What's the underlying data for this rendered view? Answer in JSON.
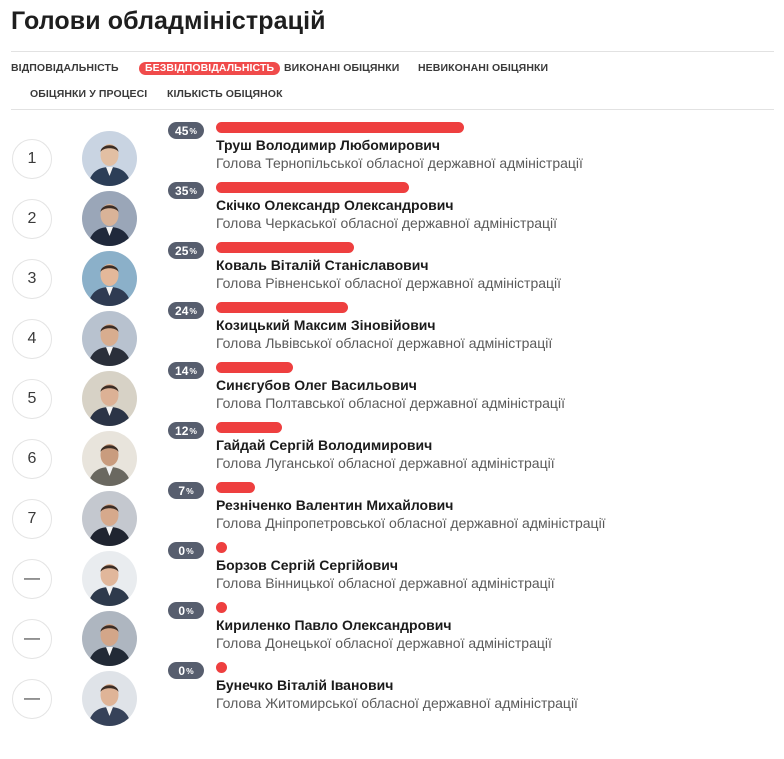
{
  "page": {
    "title": "Голови обладміністрацій"
  },
  "tabs": [
    {
      "label": "ВІДПОВІДАЛЬНІСТЬ",
      "active": false
    },
    {
      "label": "БЕЗВІДПОВІДАЛЬНІСТЬ",
      "active": true
    },
    {
      "label": "ВИКОНАНІ ОБІЦЯНКИ",
      "active": false
    },
    {
      "label": "НЕВИКОНАНІ ОБІЦЯНКИ",
      "active": false
    },
    {
      "label": "ОБІЦЯНКИ У ПРОЦЕСІ",
      "active": false
    },
    {
      "label": "КІЛЬКІСТЬ ОБІЦЯНОК",
      "active": false
    }
  ],
  "percent_sign": "%",
  "colors": {
    "bar": "#ee3f3f",
    "badge": "#575e6e",
    "active_tab": "#f04b4b"
  },
  "rows": [
    {
      "rank": "1",
      "percent": 45,
      "name": "Труш Володимир Любомирович",
      "role": "Голова Тернопільської обласної державної адміністрації"
    },
    {
      "rank": "2",
      "percent": 35,
      "name": "Скічко Олександр Олександрович",
      "role": "Голова Черкаської обласної державної адміністрації"
    },
    {
      "rank": "3",
      "percent": 25,
      "name": "Коваль Віталій Станіславович",
      "role": "Голова Рівненської обласної державної адміністрації"
    },
    {
      "rank": "4",
      "percent": 24,
      "name": "Козицький Максим Зіновійович",
      "role": "Голова Львівської обласної державної адміністрації"
    },
    {
      "rank": "5",
      "percent": 14,
      "name": "Синєгубов Олег Васильович",
      "role": "Голова Полтавської обласної державної адміністрації"
    },
    {
      "rank": "6",
      "percent": 12,
      "name": "Гайдай Сергій Володимирович",
      "role": "Голова Луганської обласної державної адміністрації"
    },
    {
      "rank": "7",
      "percent": 7,
      "name": "Резніченко Валентин Михайлович",
      "role": "Голова Дніпропетровської обласної державної адміністрації"
    },
    {
      "rank": "—",
      "percent": 0,
      "name": "Борзов Сергій Сергійович",
      "role": "Голова Вінницької обласної державної адміністрації"
    },
    {
      "rank": "—",
      "percent": 0,
      "name": "Кириленко Павло Олександрович",
      "role": "Голова Донецької обласної державної адміністрації"
    },
    {
      "rank": "—",
      "percent": 0,
      "name": "Бунечко Віталій Іванович",
      "role": "Голова Житомирської обласної державної адміністрації"
    }
  ]
}
